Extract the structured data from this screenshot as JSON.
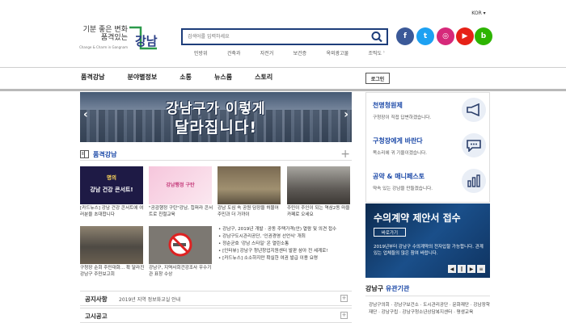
{
  "header": {
    "lang": "KOR ▾",
    "logo_line1": "기분 좋은 변화",
    "logo_line2": "품격있는",
    "logo_sub": "Change & Charm in Gangnam",
    "logo_mark": "강남",
    "search_placeholder": "검색어를 입력하세요",
    "keywords": [
      "민방위",
      "건축과",
      "자전거",
      "보건증",
      "옥외광고물",
      "조직도"
    ],
    "social": [
      {
        "name": "facebook",
        "glyph": "f",
        "color": "#3b5998"
      },
      {
        "name": "twitter",
        "glyph": "t",
        "color": "#1da1f2"
      },
      {
        "name": "instagram",
        "glyph": "◎",
        "color": "#d6297a"
      },
      {
        "name": "youtube",
        "glyph": "▶",
        "color": "#e62117"
      },
      {
        "name": "blog",
        "glyph": "b",
        "color": "#2db400"
      }
    ]
  },
  "nav": {
    "items": [
      "품격강남",
      "분야별정보",
      "소통",
      "뉴스룸",
      "스토리"
    ],
    "login": "로그인"
  },
  "banner": {
    "line1": "강남구가 이렇게",
    "line2": "달라집니다!"
  },
  "section": {
    "title": "품격강남",
    "cards": [
      {
        "img_top": "명의",
        "img_main": "강남 건강 콘서트!",
        "caption": "[카드뉴스] 강남 건강 콘서트에 여러분을 초대합니다"
      },
      {
        "img_main": "강남행정 구탄",
        "caption": "\"공감행정 구탄\"강남, 힙퍼라 콘서트로 친절교육"
      },
      {
        "caption": "강남 도심 속 공원 담장을 허물어 주민과 더 가까이"
      },
      {
        "caption": "주민이 주인이 되는 역삼2동 마을카페로 오세요"
      },
      {
        "caption": "구청장 순회 주민대화... 확 달라진 강남구 주민보고회"
      },
      {
        "caption": "강남구, 지역사회건강조사 우수기관 표창 수상"
      }
    ],
    "bullets": [
      "강남구, 2019년 개발 · 공동 주택가격(안) 열람 및 의견 접수",
      "강남구도시관리공단, '인권경영 선언식' 개최",
      "정순균호 '강남 스타일' 온 열린소통",
      "[인터뷰] 강남구 청년창업지원센터 발판 삼아 전 세계로!",
      "[카드뉴스] 소소하지만 확실한 여권 발급 이용 요령"
    ]
  },
  "notices": [
    {
      "label": "공지사항",
      "text": "2019년 지역 정보화교실 안내",
      "more": "+"
    },
    {
      "label": "고시공고",
      "text": "",
      "more": "+"
    }
  ],
  "right": {
    "blocks": [
      {
        "title": "천명청원제",
        "desc": "구청장이 직접 답변하겠습니다.",
        "icon": "megaphone-icon"
      },
      {
        "title": "구청장에게 바란다",
        "desc": "목소리에 귀 기울이겠습니다.",
        "icon": "chat-icon"
      },
      {
        "title": "공약 & 매니페스토",
        "desc": "약속 있는 강남을 만들겠습니다.",
        "icon": "bar-chart-icon"
      }
    ],
    "contract": {
      "title": "수의계약 제안서 접수",
      "button": "바로가기",
      "desc": "2019년부터 강남구 수의계약의 전자입찰 가능합니다. 관계있는 업체들의 많은 참여 바랍니다.",
      "prev": "◀",
      "pause": "‖",
      "next": "▶",
      "menu": "≡"
    },
    "org": {
      "title_plain": "강남구",
      "title_accent": "유관기관",
      "desc": "강남구의회 · 강남구보건소 · 도시관리공단 · 문화재단 · 강남장학재단 · 강남구립 · 강남구청소년상담복지센터 · 평생교육"
    }
  }
}
